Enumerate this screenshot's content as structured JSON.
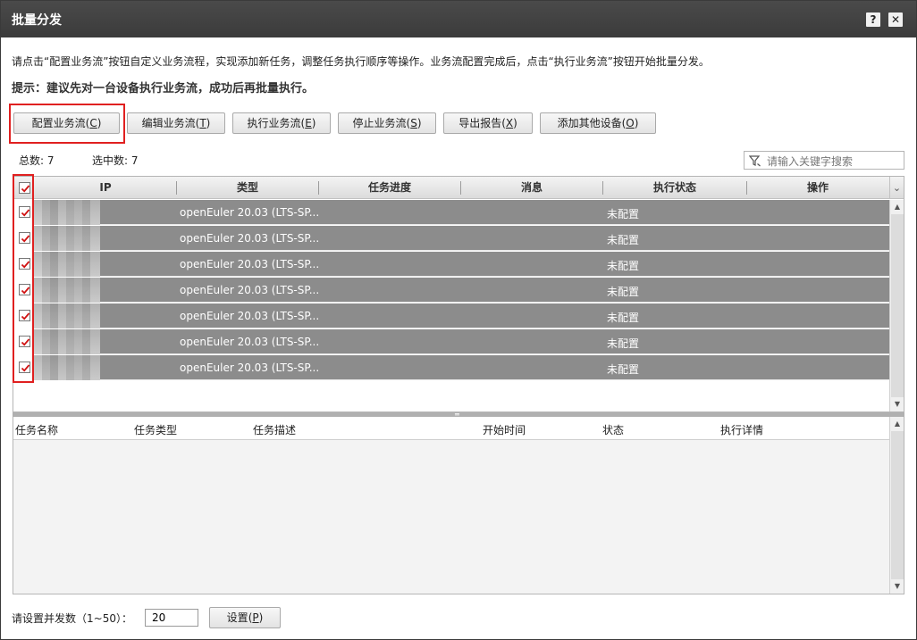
{
  "window": {
    "title": "批量分发",
    "help_label": "?",
    "close_label": "✕"
  },
  "intro": {
    "description": "请点击“配置业务流”按钮自定义业务流程，实现添加新任务，调整任务执行顺序等操作。业务流配置完成后，点击“执行业务流”按钮开始批量分发。",
    "hint": "提示：建议先对一台设备执行业务流，成功后再批量执行。"
  },
  "toolbar": {
    "configure": {
      "label": "配置业务流",
      "key": "C"
    },
    "edit": {
      "label": "编辑业务流",
      "key": "T"
    },
    "execute": {
      "label": "执行业务流",
      "key": "E"
    },
    "stop": {
      "label": "停止业务流",
      "key": "S"
    },
    "export": {
      "label": "导出报告",
      "key": "X"
    },
    "add_devices": {
      "label": "添加其他设备",
      "key": "O"
    }
  },
  "counts": {
    "total": "总数: 7",
    "selected": "选中数: 7"
  },
  "search": {
    "placeholder": "请输入关键字搜索"
  },
  "device_table": {
    "columns": [
      "IP",
      "类型",
      "任务进度",
      "消息",
      "执行状态",
      "操作"
    ],
    "rows": [
      {
        "checked": true,
        "type": "openEuler 20.03 (LTS-SP...",
        "progress": "",
        "message": "",
        "status": "未配置",
        "action": ""
      },
      {
        "checked": true,
        "type": "openEuler 20.03 (LTS-SP...",
        "progress": "",
        "message": "",
        "status": "未配置",
        "action": ""
      },
      {
        "checked": true,
        "type": "openEuler 20.03 (LTS-SP...",
        "progress": "",
        "message": "",
        "status": "未配置",
        "action": ""
      },
      {
        "checked": true,
        "type": "openEuler 20.03 (LTS-SP...",
        "progress": "",
        "message": "",
        "status": "未配置",
        "action": ""
      },
      {
        "checked": true,
        "type": "openEuler 20.03 (LTS-SP...",
        "progress": "",
        "message": "",
        "status": "未配置",
        "action": ""
      },
      {
        "checked": true,
        "type": "openEuler 20.03 (LTS-SP...",
        "progress": "",
        "message": "",
        "status": "未配置",
        "action": ""
      },
      {
        "checked": true,
        "type": "openEuler 20.03 (LTS-SP...",
        "progress": "",
        "message": "",
        "status": "未配置",
        "action": ""
      }
    ]
  },
  "task_table": {
    "columns": [
      "任务名称",
      "任务类型",
      "任务描述",
      "开始时间",
      "状态",
      "执行详情"
    ],
    "rows": []
  },
  "concurrency": {
    "label": "请设置并发数（1~50）：",
    "value": "20",
    "set_button": {
      "label": "设置",
      "key": "P"
    }
  },
  "colors": {
    "titlebar": "#3b3b3b",
    "row_selected": "#8c8c8c",
    "highlight_box": "#e02020",
    "checkmark": "#d01010"
  }
}
